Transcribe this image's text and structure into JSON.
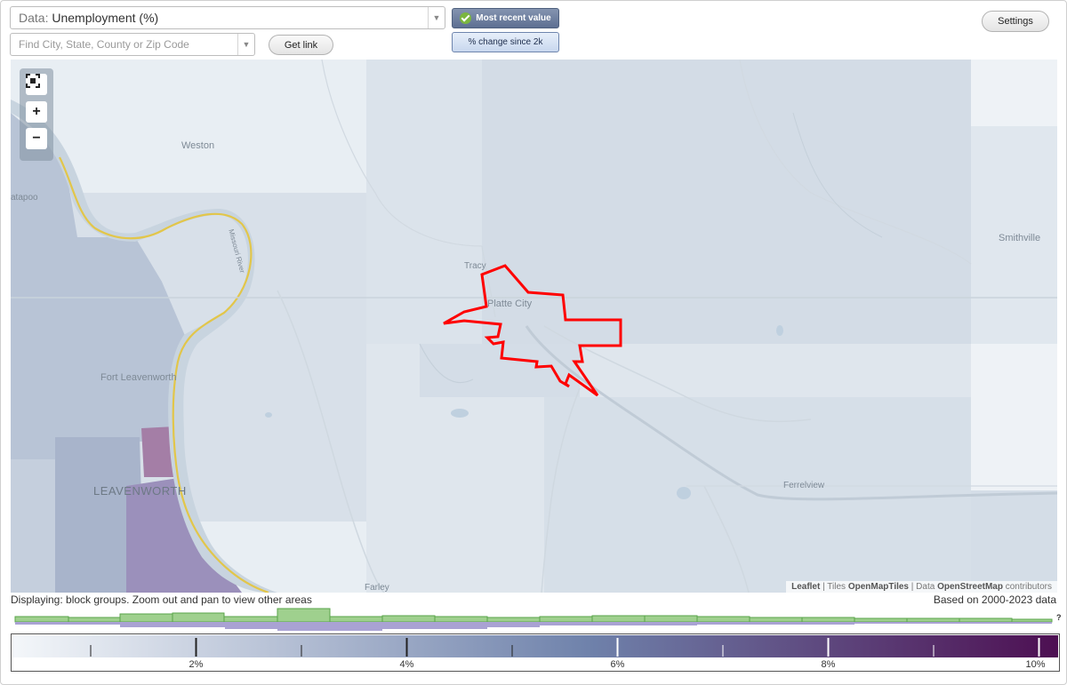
{
  "controls": {
    "data_prefix": "Data:",
    "data_value": "Unemployment (%)",
    "search_placeholder": "Find City, State, County or Zip Code",
    "get_link_label": "Get link",
    "most_recent_label": "Most recent value",
    "change_label": "% change since 2k",
    "settings_label": "Settings"
  },
  "map": {
    "zoom_in_label": "+",
    "zoom_out_label": "−",
    "places": {
      "weston": "Weston",
      "atapoo": "atapoo",
      "tracy": "Tracy",
      "platte_city": "Platte City",
      "smithville": "Smithville",
      "fort_leavenworth": "Fort Leavenworth",
      "leavenworth": "LEAVENWORTH",
      "ferrelview": "Ferrelview",
      "farley": "Farley",
      "missouri_river": "Missouri River"
    },
    "attribution": {
      "leaflet": "Leaflet",
      "sep1": " | Tiles ",
      "tiles": "OpenMapTiles",
      "sep2": " | Data ",
      "data": "OpenStreetMap",
      "contributors": " contributors"
    },
    "highlight_color": "#ff0000"
  },
  "status": {
    "displaying": "Displaying: block groups. Zoom out and pan to view other areas",
    "based_on": "Based on 2000-2023 data"
  },
  "histogram": {
    "help_label": "?"
  },
  "legend": {
    "tick_labels": [
      "2%",
      "4%",
      "6%",
      "8%",
      "10%"
    ],
    "color_start": "#f4f7fa",
    "color_mid": "#6f82ab",
    "color_end": "#4d0f52"
  }
}
